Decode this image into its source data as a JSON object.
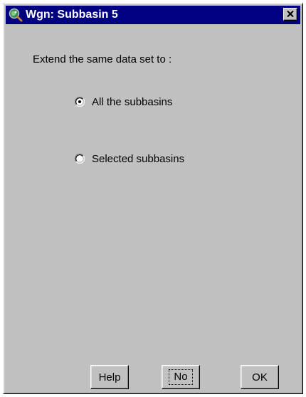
{
  "window": {
    "title": "Wgn: Subbasin 5",
    "app_icon": "magnifier-globe-icon",
    "close_icon": "close-icon"
  },
  "dialog": {
    "prompt": "Extend the same data set to :",
    "options": [
      {
        "label": "All the subbasins",
        "checked": true
      },
      {
        "label": "Selected subbasins",
        "checked": false
      }
    ]
  },
  "buttons": {
    "help_label": "Help",
    "no_label": "No",
    "ok_label": "OK",
    "focused": "No"
  },
  "colors": {
    "titlebar": "#000080",
    "face": "#c0c0c0"
  }
}
